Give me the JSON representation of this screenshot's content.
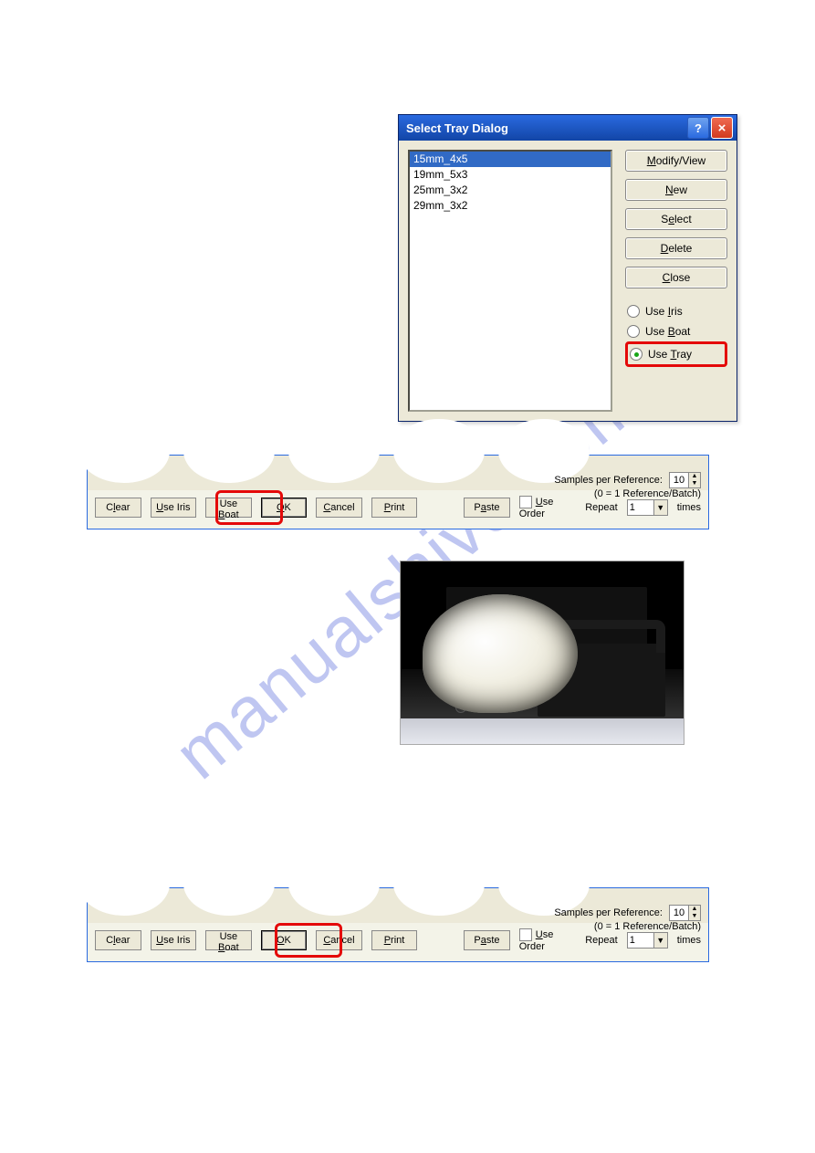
{
  "dialog": {
    "title": "Select Tray Dialog",
    "list": [
      "15mm_4x5",
      "19mm_5x3",
      "25mm_3x2",
      "29mm_3x2"
    ],
    "selected_index": 0,
    "buttons": {
      "modify": "Modify/View",
      "new": "New",
      "select": "Select",
      "delete": "Delete",
      "close": "Close"
    },
    "radios": {
      "iris": "Use Iris",
      "boat": "Use Boat",
      "tray": "Use Tray"
    },
    "radio_selected": "tray"
  },
  "strip": {
    "samples_line1": "Samples per Reference:",
    "samples_line2": "(0 = 1 Reference/Batch)",
    "samples_value": "10",
    "btn_clear": "Clear",
    "btn_iris": "Use Iris",
    "btn_boat": "Use Boat",
    "btn_ok": "OK",
    "btn_cancel": "Cancel",
    "btn_print": "Print",
    "btn_paste": "Paste",
    "chk_use_order": "Use Order",
    "repeat_label": "Repeat",
    "repeat_value": "1",
    "times_label": "times"
  },
  "watermark": "manualshive.com"
}
